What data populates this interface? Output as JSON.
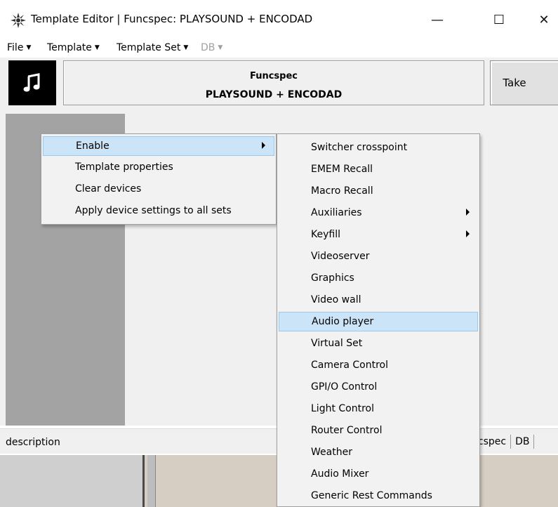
{
  "window": {
    "title": "Template Editor | Funcspec: PLAYSOUND + ENCODAD",
    "minimize_glyph": "—",
    "maximize_glyph": "☐",
    "close_glyph": "✕"
  },
  "menubar": {
    "items": [
      {
        "label": "File"
      },
      {
        "label": "Template"
      },
      {
        "label": "Template Set"
      },
      {
        "label": "DB"
      }
    ]
  },
  "header": {
    "icon": "music-note-icon",
    "line1": "Funcspec",
    "line2": "PLAYSOUND + ENCODAD",
    "take_label": "Take"
  },
  "statusbar": {
    "left": "description",
    "right_1": "ncspec",
    "right_2": "DB"
  },
  "context_menu": {
    "items": [
      {
        "label": "Enable",
        "has_submenu": true,
        "highlighted": true
      },
      {
        "label": "Template properties"
      },
      {
        "label": "Clear devices"
      },
      {
        "label": "Apply device settings to all sets"
      }
    ]
  },
  "submenu": {
    "items": [
      {
        "label": "Switcher crosspoint"
      },
      {
        "label": "EMEM Recall"
      },
      {
        "label": "Macro Recall"
      },
      {
        "label": "Auxiliaries",
        "has_submenu": true
      },
      {
        "label": "Keyfill",
        "has_submenu": true
      },
      {
        "label": "Videoserver"
      },
      {
        "label": "Graphics"
      },
      {
        "label": "Video wall"
      },
      {
        "label": "Audio player",
        "highlighted": true
      },
      {
        "label": "Virtual Set"
      },
      {
        "label": "Camera Control"
      },
      {
        "label": "GPI/O Control"
      },
      {
        "label": "Light Control"
      },
      {
        "label": "Router Control"
      },
      {
        "label": "Weather"
      },
      {
        "label": "Audio Mixer"
      },
      {
        "label": "Generic Rest Commands"
      }
    ]
  },
  "colors": {
    "highlight": "#cce4f7",
    "highlight_border": "#99c9ef",
    "left_panel": "#a3a3a3",
    "music_box": "#000000"
  }
}
